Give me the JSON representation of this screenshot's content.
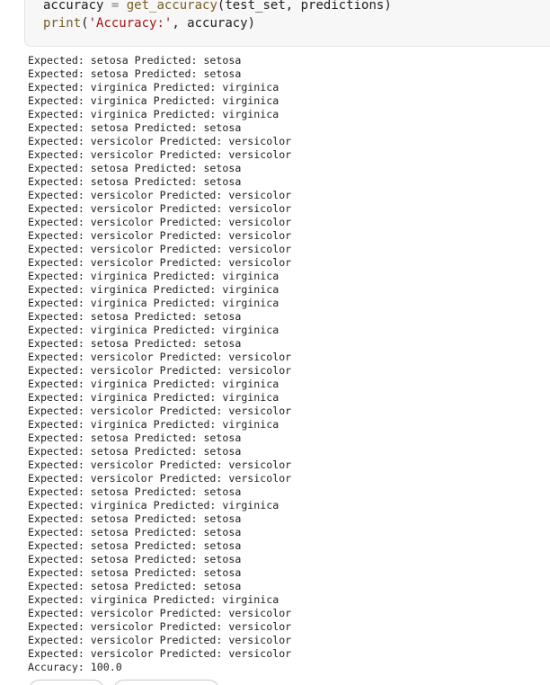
{
  "code": {
    "line1": {
      "var": "accuracy",
      "op": " = ",
      "fn": "get_accuracy",
      "args": "(test_set, predictions)"
    },
    "line2": {
      "fn": "print",
      "open": "(",
      "str": "'Accuracy:'",
      "rest": ", accuracy)"
    }
  },
  "output": {
    "lines": [
      "Expected: setosa Predicted: setosa",
      "Expected: setosa Predicted: setosa",
      "Expected: virginica Predicted: virginica",
      "Expected: virginica Predicted: virginica",
      "Expected: virginica Predicted: virginica",
      "Expected: setosa Predicted: setosa",
      "Expected: versicolor Predicted: versicolor",
      "Expected: versicolor Predicted: versicolor",
      "Expected: setosa Predicted: setosa",
      "Expected: setosa Predicted: setosa",
      "Expected: versicolor Predicted: versicolor",
      "Expected: versicolor Predicted: versicolor",
      "Expected: versicolor Predicted: versicolor",
      "Expected: versicolor Predicted: versicolor",
      "Expected: versicolor Predicted: versicolor",
      "Expected: versicolor Predicted: versicolor",
      "Expected: virginica Predicted: virginica",
      "Expected: virginica Predicted: virginica",
      "Expected: virginica Predicted: virginica",
      "Expected: setosa Predicted: setosa",
      "Expected: virginica Predicted: virginica",
      "Expected: setosa Predicted: setosa",
      "Expected: versicolor Predicted: versicolor",
      "Expected: versicolor Predicted: versicolor",
      "Expected: virginica Predicted: virginica",
      "Expected: virginica Predicted: virginica",
      "Expected: versicolor Predicted: versicolor",
      "Expected: virginica Predicted: virginica",
      "Expected: setosa Predicted: setosa",
      "Expected: setosa Predicted: setosa",
      "Expected: versicolor Predicted: versicolor",
      "Expected: versicolor Predicted: versicolor",
      "Expected: setosa Predicted: setosa",
      "Expected: virginica Predicted: virginica",
      "Expected: setosa Predicted: setosa",
      "Expected: setosa Predicted: setosa",
      "Expected: setosa Predicted: setosa",
      "Expected: setosa Predicted: setosa",
      "Expected: setosa Predicted: setosa",
      "Expected: setosa Predicted: setosa",
      "Expected: virginica Predicted: virginica",
      "Expected: versicolor Predicted: versicolor",
      "Expected: versicolor Predicted: versicolor",
      "Expected: versicolor Predicted: versicolor",
      "Expected: versicolor Predicted: versicolor",
      "Accuracy: 100.0"
    ]
  },
  "colors": {
    "cell_background": "#f7f7f7",
    "string": "#a31515",
    "function": "#795e26",
    "text": "#212121"
  }
}
